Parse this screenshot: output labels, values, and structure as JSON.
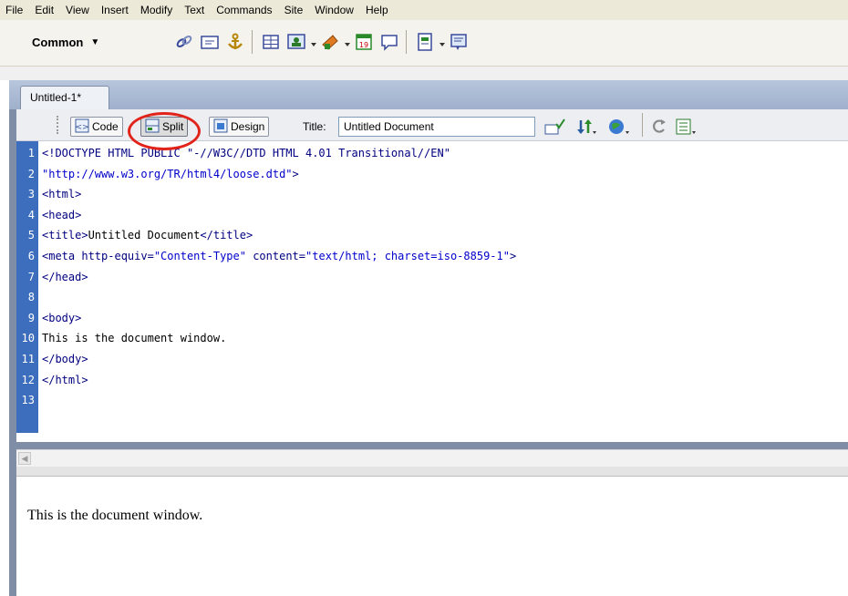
{
  "menubar": {
    "items": [
      "File",
      "Edit",
      "View",
      "Insert",
      "Modify",
      "Text",
      "Commands",
      "Site",
      "Window",
      "Help"
    ]
  },
  "insertbar": {
    "category": "Common",
    "tools": [
      "hyperlink-icon",
      "email-link-icon",
      "named-anchor-icon",
      "table-icon",
      "images-icon",
      "media-icon",
      "date-icon",
      "comment-icon",
      "templates-icon",
      "tag-chooser-icon"
    ]
  },
  "document": {
    "tab_label": "Untitled-1*",
    "toolbar": {
      "code_label": "Code",
      "split_label": "Split",
      "design_label": "Design",
      "title_label": "Title:",
      "title_value": "Untitled Document"
    },
    "code_lines": [
      {
        "num": "1",
        "parts": [
          {
            "t": "tag",
            "v": "<!DOCTYPE HTML PUBLIC \"-//W3C//DTD HTML 4.01 Transitional//EN\""
          }
        ]
      },
      {
        "num": "2",
        "parts": [
          {
            "t": "str",
            "v": "\"http://www.w3.org/TR/html4/loose.dtd\""
          },
          {
            "t": "tag",
            "v": ">"
          }
        ]
      },
      {
        "num": "3",
        "parts": [
          {
            "t": "tag",
            "v": "<html>"
          }
        ]
      },
      {
        "num": "4",
        "parts": [
          {
            "t": "tag",
            "v": "<head>"
          }
        ]
      },
      {
        "num": "5",
        "parts": [
          {
            "t": "tag",
            "v": "<title>"
          },
          {
            "t": "txt",
            "v": "Untitled Document"
          },
          {
            "t": "tag",
            "v": "</title>"
          }
        ]
      },
      {
        "num": "6",
        "parts": [
          {
            "t": "tag",
            "v": "<meta http-equiv="
          },
          {
            "t": "str",
            "v": "\"Content-Type\""
          },
          {
            "t": "tag",
            "v": " content="
          },
          {
            "t": "str",
            "v": "\"text/html; charset=iso-8859-1\""
          },
          {
            "t": "tag",
            "v": ">"
          }
        ]
      },
      {
        "num": "7",
        "parts": [
          {
            "t": "tag",
            "v": "</head>"
          }
        ]
      },
      {
        "num": "8",
        "parts": []
      },
      {
        "num": "9",
        "parts": [
          {
            "t": "tag",
            "v": "<body>"
          }
        ]
      },
      {
        "num": "10",
        "parts": [
          {
            "t": "txt",
            "v": "This is the document window."
          }
        ]
      },
      {
        "num": "11",
        "parts": [
          {
            "t": "tag",
            "v": "</body>"
          }
        ]
      },
      {
        "num": "12",
        "parts": [
          {
            "t": "tag",
            "v": "</html>"
          }
        ]
      },
      {
        "num": "13",
        "parts": []
      }
    ],
    "design_text": "This is the document window."
  },
  "colors": {
    "gutter": "#3c6ebd",
    "annotation": "#e2231a"
  }
}
